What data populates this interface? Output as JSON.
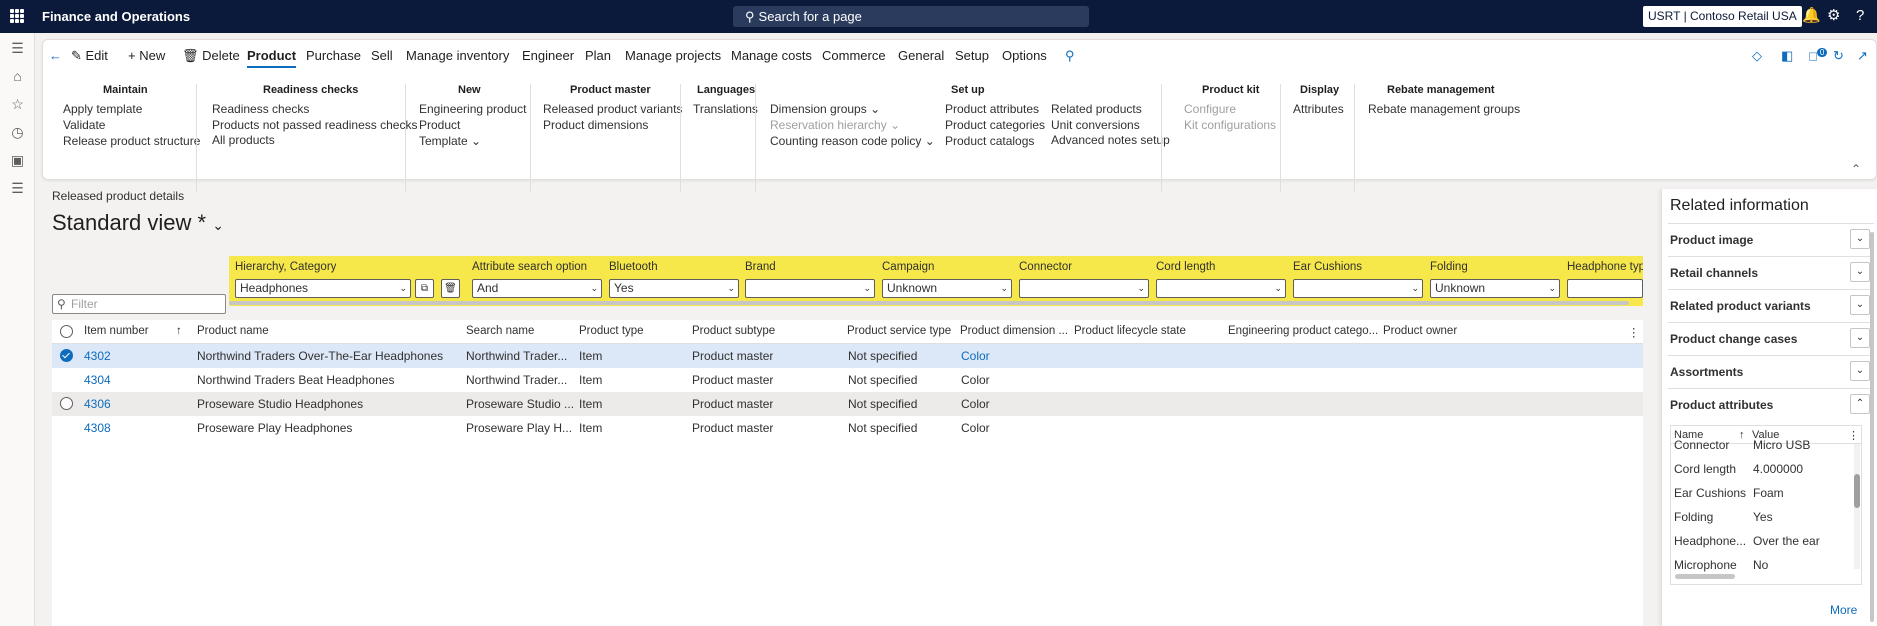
{
  "topbar": {
    "app_title": "Finance and Operations",
    "search_placeholder": "Search for a page",
    "company": "USRT | Contoso Retail USA",
    "icons": [
      "waffle-icon",
      "search-icon",
      "bell-icon",
      "gear-icon",
      "help-icon"
    ],
    "bar_color": "#0b1a3a"
  },
  "leftnav": {
    "icons": [
      "hamburger-icon",
      "home-icon",
      "star-icon",
      "clock-icon",
      "workspace-icon",
      "list-icon"
    ]
  },
  "ribbon": {
    "tabs": [
      "Edit",
      "New",
      "Delete",
      "Product",
      "Purchase",
      "Sell",
      "Manage inventory",
      "Engineer",
      "Plan",
      "Manage projects",
      "Manage costs",
      "Commerce",
      "General",
      "Setup",
      "Options"
    ],
    "active_tab": "Product",
    "groups": [
      {
        "header": "Maintain",
        "items": [
          "Apply template",
          "Validate",
          "Release product structure"
        ]
      },
      {
        "header": "Readiness checks",
        "items": [
          "Readiness checks",
          "Products not passed readiness checks",
          "All products"
        ]
      },
      {
        "header": "New",
        "items": [
          "Engineering product",
          "Product",
          "Template"
        ]
      },
      {
        "header": "Product master",
        "items": [
          "Released product variants",
          "Product dimensions"
        ]
      },
      {
        "header": "Languages",
        "items": [
          "Translations"
        ]
      },
      {
        "header": "Set up",
        "items": [
          "Dimension groups",
          "Reservation hierarchy",
          "Counting reason code policy",
          "Product attributes",
          "Product categories",
          "Product catalogs",
          "Related products",
          "Unit conversions",
          "Advanced notes setup"
        ]
      },
      {
        "header": "Product kit",
        "items": [
          "Configure",
          "Kit configurations"
        ]
      },
      {
        "header": "Display",
        "items": [
          "Attributes"
        ]
      },
      {
        "header": "Rebate management",
        "items": [
          "Rebate management groups"
        ]
      }
    ],
    "notification_count": "0"
  },
  "page": {
    "breadcrumb": "Released product details",
    "view_title": "Standard view *"
  },
  "filters": {
    "accent": "#f6e84a",
    "fields": [
      {
        "label": "Hierarchy, Category",
        "value": "Headphones"
      },
      {
        "label": "Attribute search option",
        "value": "And"
      },
      {
        "label": "Bluetooth",
        "value": "Yes"
      },
      {
        "label": "Brand",
        "value": ""
      },
      {
        "label": "Campaign",
        "value": "Unknown"
      },
      {
        "label": "Connector",
        "value": ""
      },
      {
        "label": "Cord length",
        "value": ""
      },
      {
        "label": "Ear Cushions",
        "value": ""
      },
      {
        "label": "Folding",
        "value": "Unknown"
      },
      {
        "label": "Headphone type",
        "value": ""
      }
    ],
    "filter_placeholder": "Filter"
  },
  "grid": {
    "columns": [
      "Item number",
      "Product name",
      "Search name",
      "Product type",
      "Product subtype",
      "Product service type",
      "Product dimension ...",
      "Product lifecycle state",
      "Engineering product catego...",
      "Product owner"
    ],
    "rows": [
      {
        "item": "4302",
        "name": "Northwind Traders Over-The-Ear Headphones",
        "search": "Northwind Trader...",
        "type": "Item",
        "subtype": "Product master",
        "service": "Not specified",
        "dimension": "Color",
        "selected": true
      },
      {
        "item": "4304",
        "name": "Northwind Traders Beat Headphones",
        "search": "Northwind Trader...",
        "type": "Item",
        "subtype": "Product master",
        "service": "Not specified",
        "dimension": "Color",
        "selected": false
      },
      {
        "item": "4306",
        "name": "Proseware Studio Headphones",
        "search": "Proseware Studio ...",
        "type": "Item",
        "subtype": "Product master",
        "service": "Not specified",
        "dimension": "Color",
        "selected": false
      },
      {
        "item": "4308",
        "name": "Proseware Play Headphones",
        "search": "Proseware Play H...",
        "type": "Item",
        "subtype": "Product master",
        "service": "Not specified",
        "dimension": "Color",
        "selected": false
      }
    ]
  },
  "related": {
    "title": "Related information",
    "fasttabs": [
      "Product image",
      "Retail channels",
      "Related product variants",
      "Product change cases",
      "Assortments",
      "Product attributes"
    ],
    "attr_headers": [
      "Name",
      "Value"
    ],
    "attributes": [
      {
        "name": "Connector",
        "value": "Micro USB"
      },
      {
        "name": "Cord length",
        "value": "4.000000"
      },
      {
        "name": "Ear Cushions",
        "value": "Foam"
      },
      {
        "name": "Folding",
        "value": "Yes"
      },
      {
        "name": "Headphone...",
        "value": "Over the ear"
      },
      {
        "name": "Microphone",
        "value": "No"
      }
    ],
    "more": "More"
  }
}
